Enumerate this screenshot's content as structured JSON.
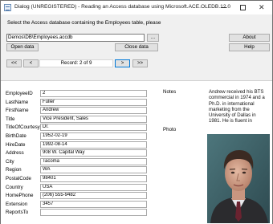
{
  "window": {
    "title": "Dialog (UNREGISTERED) - Reading an Access database using Microsoft.ACE.OLEDB.12.0"
  },
  "prompt": "Select the Access database containing the Employees table, please",
  "path_value": "Demos\\DB\\Employees.accdb",
  "buttons": {
    "browse": "...",
    "about": "About",
    "open": "Open data",
    "close": "Close data",
    "help": "Help"
  },
  "nav": {
    "first": "<<",
    "prev": "<",
    "record": "Record: 2 of 9",
    "next": ">",
    "last": ">>"
  },
  "fields": [
    {
      "label": "EmployeeID",
      "value": "2"
    },
    {
      "label": "LastName",
      "value": "Fuller"
    },
    {
      "label": "FirstName",
      "value": "Andrew"
    },
    {
      "label": "Title",
      "value": "Vice President, Sales"
    },
    {
      "label": "TitleOfCourtesy",
      "value": "Dr."
    },
    {
      "label": "BirthDate",
      "value": "1952-02-19"
    },
    {
      "label": "HireDate",
      "value": "1992-08-14"
    },
    {
      "label": "Address",
      "value": "908 W. Capital Way"
    },
    {
      "label": "City",
      "value": "Tacoma"
    },
    {
      "label": "Region",
      "value": "WA"
    },
    {
      "label": "PostalCode",
      "value": "98401"
    },
    {
      "label": "Country",
      "value": "USA"
    },
    {
      "label": "HomePhone",
      "value": "(206) 555-9482"
    },
    {
      "label": "Extension",
      "value": "3457"
    },
    {
      "label": "ReportsTo",
      "value": ""
    }
  ],
  "notes": {
    "label": "Notes",
    "text": "Andrew received his BTS commercial in 1974 and a Ph.D. in international marketing from the University of Dallas in 1981.  He is fluent in French and Italian and reads German.  He joined the company as"
  },
  "photo": {
    "label": "Photo"
  },
  "icons": {
    "app": "dialog-window-icon",
    "minimize": "minimize-icon",
    "maximize": "maximize-icon",
    "close": "close-icon"
  }
}
